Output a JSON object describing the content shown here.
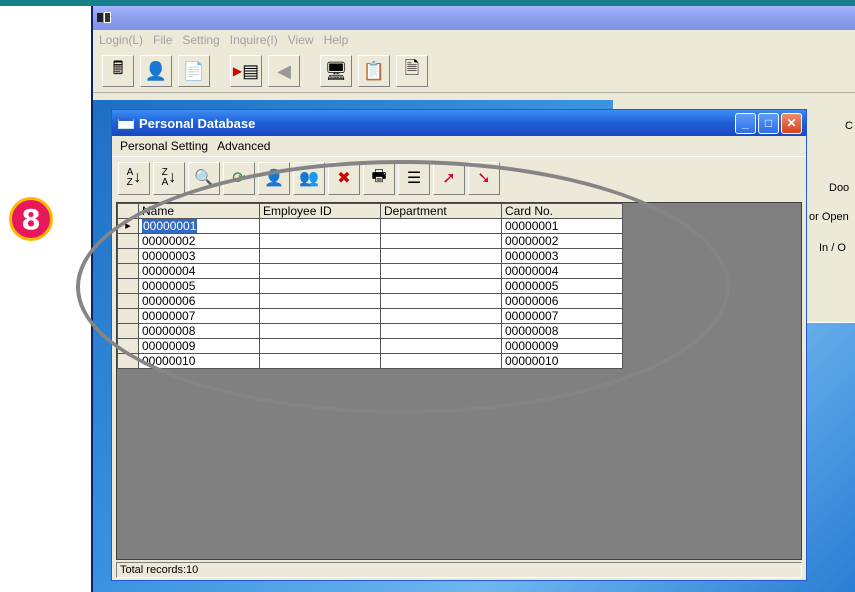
{
  "main_menu": [
    "Login(L)",
    "File",
    "Setting",
    "Inquire(I)",
    "View",
    "Help"
  ],
  "main_toolbar_icons": [
    "calculator-icon",
    "person-edit-icon",
    "document-icon",
    "play-document-icon",
    "gray-arrow-icon",
    "monitor-icon",
    "clipboard-icon",
    "document-search-icon"
  ],
  "right_panel": {
    "t1": "C",
    "t2": "Doo",
    "t3": "or Open",
    "t4": "In / O"
  },
  "dialog": {
    "title": "Personal Database",
    "menu": [
      "Personal Setting",
      "Advanced"
    ],
    "toolbar_icons": [
      "sort-ascending-icon",
      "sort-descending-icon",
      "search-magnifier-icon",
      "refresh-icon",
      "person-card-icon",
      "group-icon",
      "delete-document-icon",
      "printer-icon",
      "person-list-icon",
      "export-icon",
      "import-icon"
    ],
    "columns": [
      "Name",
      "Employee ID",
      "Department",
      "Card No."
    ],
    "rows": [
      {
        "name": "00000001",
        "employee_id": "",
        "department": "",
        "card": "00000001"
      },
      {
        "name": "00000002",
        "employee_id": "",
        "department": "",
        "card": "00000002"
      },
      {
        "name": "00000003",
        "employee_id": "",
        "department": "",
        "card": "00000003"
      },
      {
        "name": "00000004",
        "employee_id": "",
        "department": "",
        "card": "00000004"
      },
      {
        "name": "00000005",
        "employee_id": "",
        "department": "",
        "card": "00000005"
      },
      {
        "name": "00000006",
        "employee_id": "",
        "department": "",
        "card": "00000006"
      },
      {
        "name": "00000007",
        "employee_id": "",
        "department": "",
        "card": "00000007"
      },
      {
        "name": "00000008",
        "employee_id": "",
        "department": "",
        "card": "00000008"
      },
      {
        "name": "00000009",
        "employee_id": "",
        "department": "",
        "card": "00000009"
      },
      {
        "name": "00000010",
        "employee_id": "",
        "department": "",
        "card": "00000010"
      }
    ],
    "status": "Total records:10"
  },
  "badge": "8",
  "colors": {
    "badge": "#e8195a",
    "badge_border": "#ffb800",
    "title_bar": "#1f5fd6",
    "selection": "#316ac5"
  }
}
